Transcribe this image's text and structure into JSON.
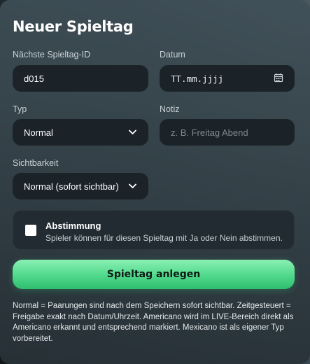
{
  "form": {
    "title": "Neuer Spieltag",
    "id_label": "Nächste Spieltag-ID",
    "id_value": "d015",
    "date_label": "Datum",
    "date_placeholder": "TT.mm.jjjj",
    "type_label": "Typ",
    "type_value": "Normal",
    "note_label": "Notiz",
    "note_placeholder": "z. B. Freitag Abend",
    "visibility_label": "Sichtbarkeit",
    "visibility_value": "Normal (sofort sichtbar)",
    "vote": {
      "title": "Abstimmung",
      "description": "Spieler können für diesen Spieltag mit Ja oder Nein abstimmen.",
      "checked": false
    },
    "submit_label": "Spieltag anlegen",
    "info_text": "Normal = Paarungen sind nach dem Speichern sofort sichtbar. Zeitgesteuert = Freigabe exakt nach Datum/Uhrzeit. Americano wird im LIVE-Bereich direkt als Americano erkannt und entsprechend markiert. Mexicano ist als eigener Typ vorbereitet."
  },
  "icons": {
    "calendar": "calendar-icon",
    "chevron": "chevron-down-icon"
  },
  "colors": {
    "accent": "#4fd88b",
    "field_bg": "#1b2329"
  }
}
